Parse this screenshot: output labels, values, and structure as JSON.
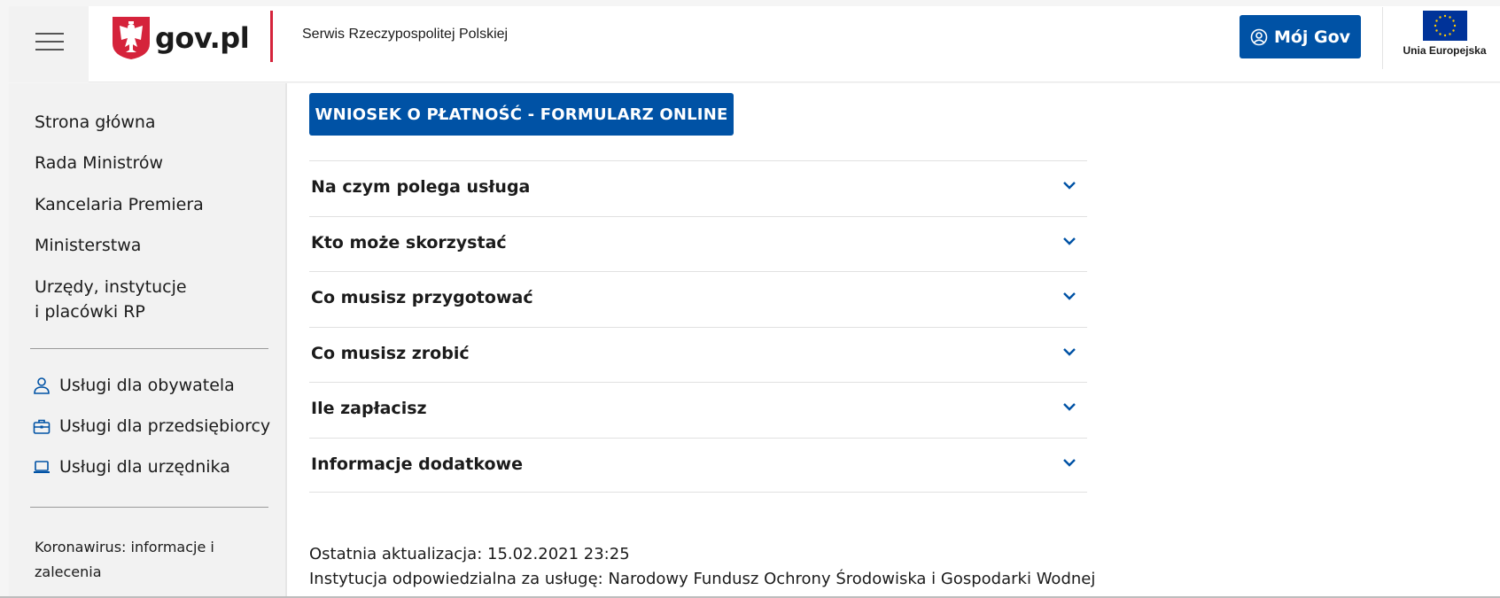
{
  "header": {
    "logo_text": "gov.pl",
    "service_name": "Serwis Rzeczypospolitej Polskiej",
    "login_button": "Mój Gov",
    "eu_label": "Unia Europejska"
  },
  "sidebar": {
    "main_nav": [
      {
        "label": "Strona główna"
      },
      {
        "label": "Rada Ministrów"
      },
      {
        "label": "Kancelaria Premiera"
      },
      {
        "label": "Ministerstwa"
      },
      {
        "label_line1": "Urzędy, instytucje",
        "label_line2": "i placówki RP"
      }
    ],
    "services": [
      {
        "label": "Usługi dla obywatela",
        "icon": "person-icon"
      },
      {
        "label": "Usługi dla przedsiębiorcy",
        "icon": "briefcase-icon"
      },
      {
        "label": "Usługi dla urzędnika",
        "icon": "laptop-icon"
      }
    ],
    "corona_line1": "Koronawirus: informacje i",
    "corona_line2": "zalecenia"
  },
  "main": {
    "cta_button": "WNIOSEK O PŁATNOŚĆ - FORMULARZ ONLINE",
    "accordion": [
      {
        "label": "Na czym polega usługa"
      },
      {
        "label": "Kto może skorzystać"
      },
      {
        "label": "Co musisz przygotować"
      },
      {
        "label": "Co musisz zrobić"
      },
      {
        "label": "Ile zapłacisz"
      },
      {
        "label": "Informacje dodatkowe"
      }
    ],
    "last_update": "Ostatnia aktualizacja: 15.02.2021 23:25",
    "institution": "Instytucja odpowiedzialna za usługę: Narodowy Fundusz Ochrony Środowiska i Gospodarki Wodnej"
  },
  "colors": {
    "primary_blue": "#0052a5",
    "brand_red": "#d5233b",
    "eu_blue": "#003399",
    "eu_star": "#ffcc00"
  }
}
